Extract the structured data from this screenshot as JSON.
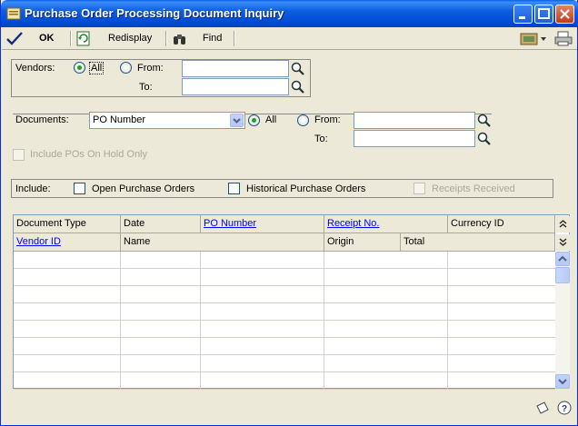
{
  "window": {
    "title": "Purchase Order Processing Document Inquiry"
  },
  "toolbar": {
    "ok_label": "OK",
    "redisplay_label": "Redisplay",
    "find_label": "Find"
  },
  "vendors": {
    "label": "Vendors:",
    "all_label": "All",
    "from_label": "From:",
    "to_label": "To:",
    "selected": "All",
    "from_value": "",
    "to_value": ""
  },
  "documents": {
    "label": "Documents:",
    "type_value": "PO Number",
    "all_label": "All",
    "from_label": "From:",
    "to_label": "To:",
    "selected": "All",
    "from_value": "",
    "to_value": ""
  },
  "hold_only": {
    "label": "Include POs On Hold Only",
    "checked": false,
    "enabled": false
  },
  "include": {
    "label": "Include:",
    "open_label": "Open Purchase Orders",
    "historical_label": "Historical Purchase Orders",
    "receipts_label": "Receipts Received"
  },
  "grid": {
    "headers_row1": [
      "Document Type",
      "Date",
      "PO Number",
      "Receipt No.",
      "Currency ID"
    ],
    "headers_row2": [
      "Vendor ID",
      "Name",
      "Origin",
      "Total"
    ],
    "empty_rows": 8
  },
  "colors": {
    "titlebar": "#0054e3",
    "window_bg": "#ece9d8",
    "link": "#0000ff"
  }
}
